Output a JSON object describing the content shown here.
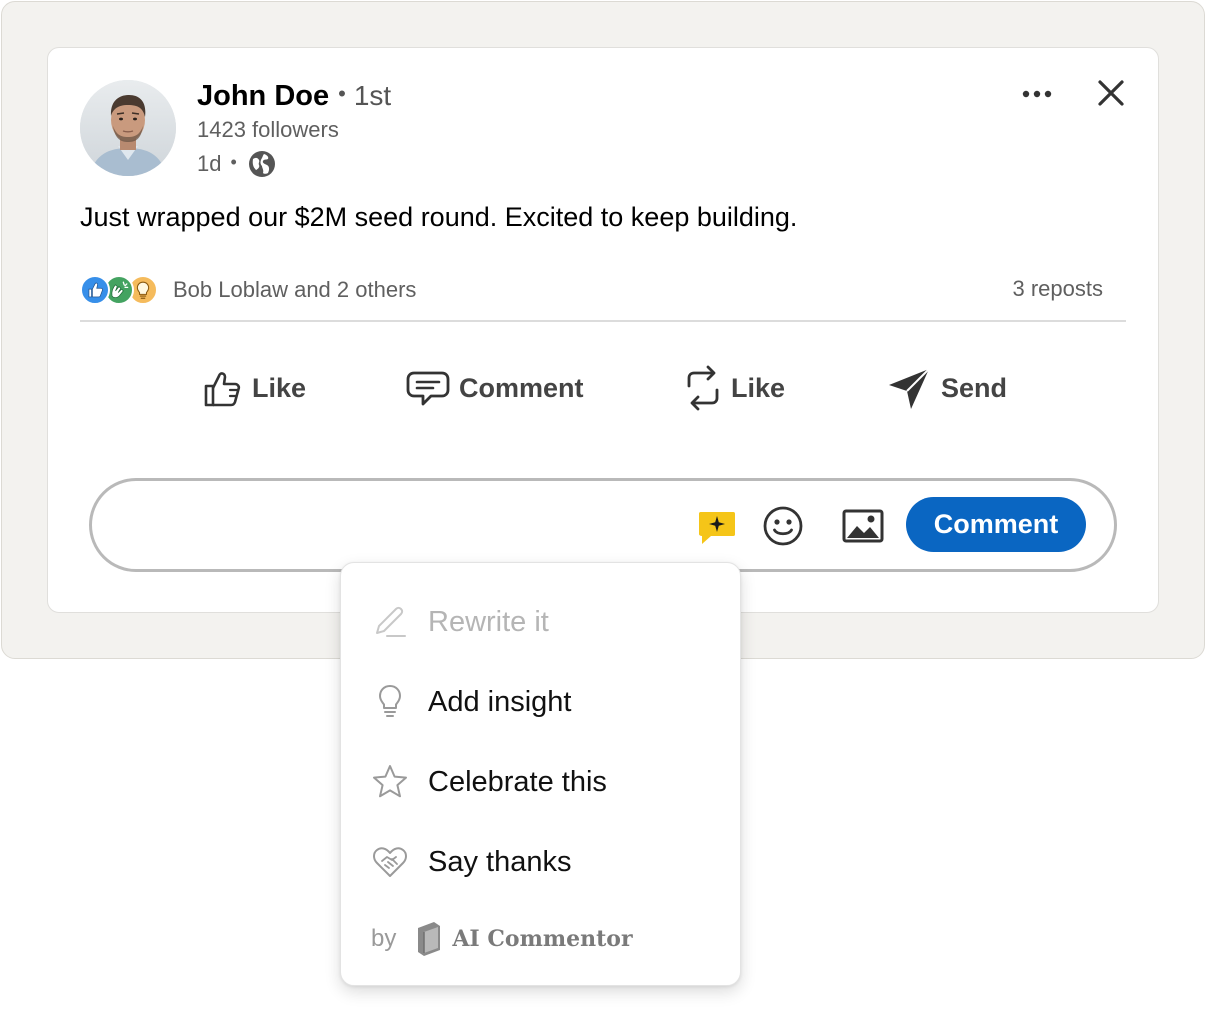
{
  "post": {
    "author_name": "John Doe",
    "separator": "•",
    "connection_degree": "1st",
    "followers": "1423 followers",
    "time": "1d",
    "meta_separator": "•",
    "visibility_icon": "globe-icon",
    "text": "Just wrapped our $2M seed round. Excited to keep building.",
    "reactions_text": "Bob Loblaw and 2 others",
    "reaction_icons": [
      "like-reaction-icon",
      "celebrate-reaction-icon",
      "insightful-reaction-icon"
    ],
    "reposts_text": "3 reposts"
  },
  "actions": {
    "like_label": "Like",
    "comment_label": "Comment",
    "repost_label": "Like",
    "send_label": "Send"
  },
  "comment_box": {
    "value": "",
    "placeholder": "",
    "submit_label": "Comment"
  },
  "ai_menu": {
    "items": [
      {
        "label": "Rewrite it",
        "icon": "pencil-icon",
        "disabled": true
      },
      {
        "label": "Add insight",
        "icon": "lightbulb-icon",
        "disabled": false
      },
      {
        "label": "Celebrate this",
        "icon": "star-icon",
        "disabled": false
      },
      {
        "label": "Say thanks",
        "icon": "heart-handshake-icon",
        "disabled": false
      }
    ],
    "footer_by": "by",
    "brand_name": "AI Commentor"
  },
  "colors": {
    "accent": "#0a66c2",
    "backdrop": "#f3f2ef",
    "ai_button": "#f5c518",
    "like_reaction": "#378fe9",
    "celebrate_reaction": "#44a361",
    "insight_reaction": "#f5bb5c"
  }
}
